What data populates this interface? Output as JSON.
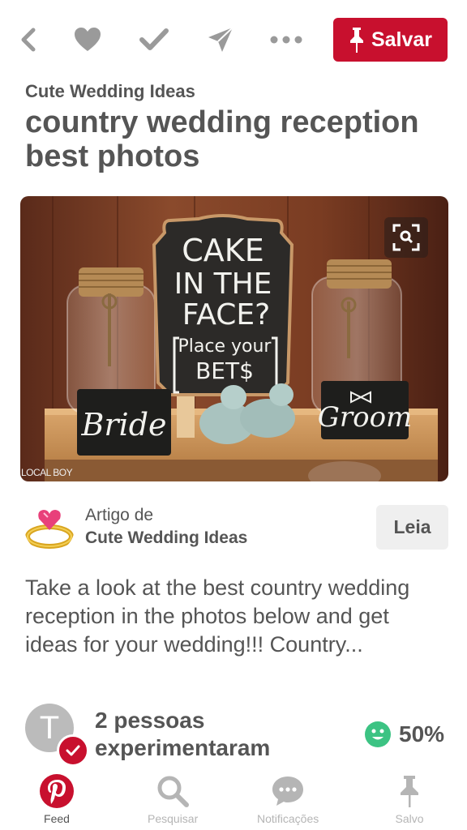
{
  "topbar": {
    "icons": [
      "back-icon",
      "heart-icon",
      "check-icon",
      "send-icon",
      "more-icon"
    ],
    "save_label": "Salvar",
    "colors": {
      "accent": "#c8102e",
      "icon": "#9a9a9a"
    }
  },
  "pin": {
    "board": "Cute Wedding Ideas",
    "title": "country wedding reception best photos",
    "photo": {
      "sign_text": [
        "CAKE",
        "IN THE",
        "FACE?",
        "Place your",
        "BET$"
      ],
      "bride_label": "Bride",
      "groom_label": "Groom",
      "watermark": "LOCAL BOY"
    }
  },
  "article": {
    "label": "Artigo de",
    "source": "Cute Wedding Ideas",
    "read_label": "Leia"
  },
  "description": "Take a look at the best country wedding reception in the photos below and get ideas for your wedding!!! Country...",
  "tried": {
    "avatar_letter": "T",
    "text": "2 pessoas experimentaram",
    "percent": "50%"
  },
  "nav": {
    "items": [
      {
        "label": "Feed",
        "icon": "pinterest-logo-icon",
        "active": true
      },
      {
        "label": "Pesquisar",
        "icon": "search-icon"
      },
      {
        "label": "Notificações",
        "icon": "chat-bubble-icon"
      },
      {
        "label": "Salvo",
        "icon": "pin-icon"
      }
    ]
  }
}
